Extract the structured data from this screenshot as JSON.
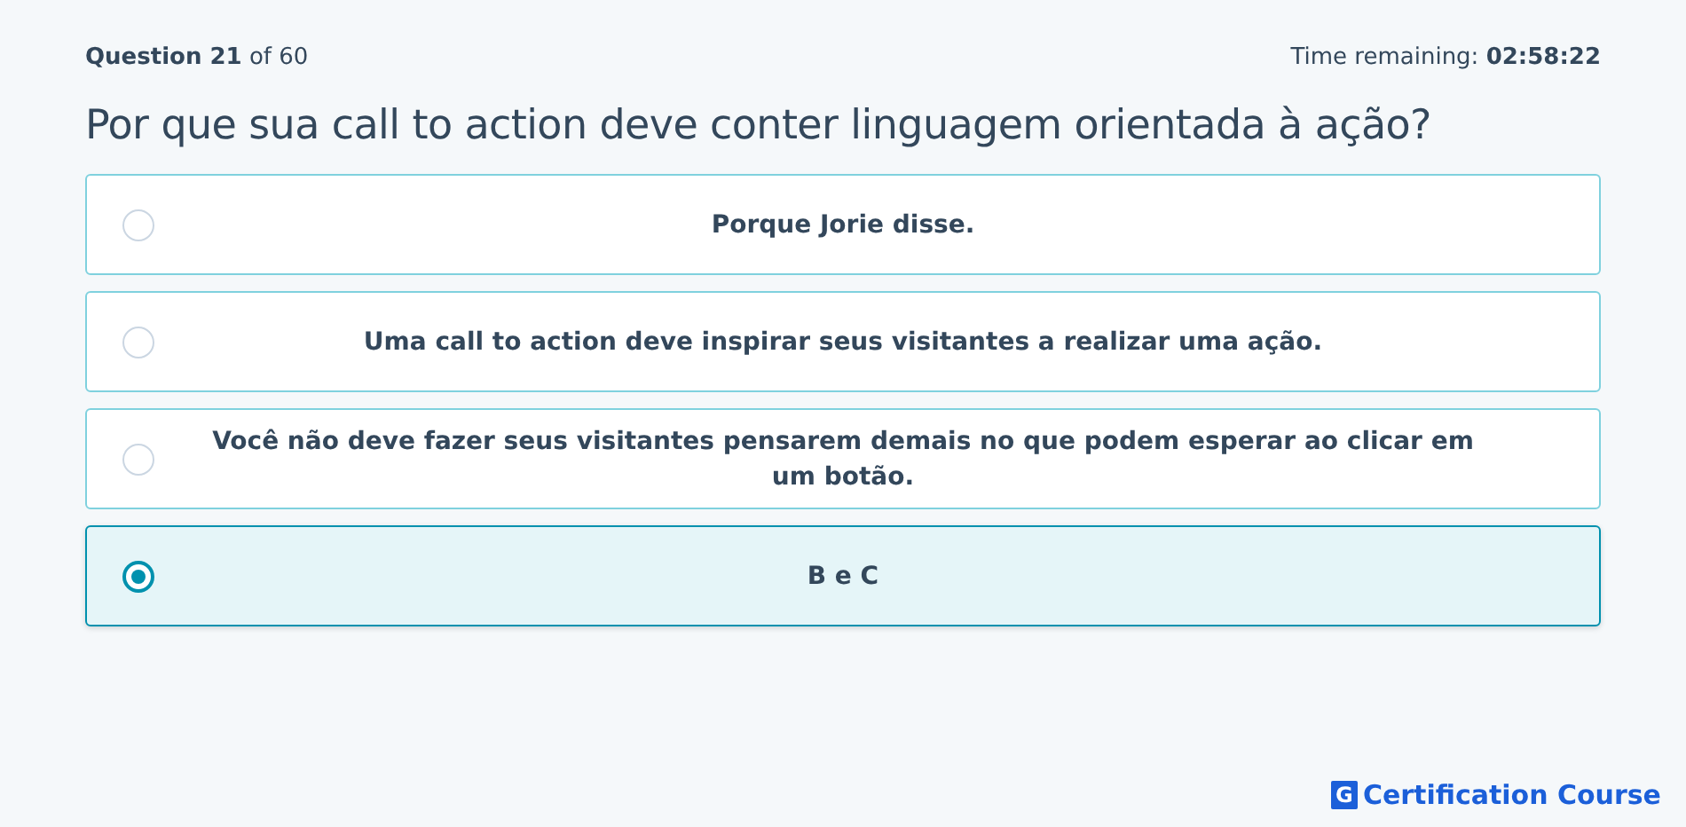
{
  "header": {
    "progress": "**Question 21** of 60",
    "timer": "Time remaining: **02:58:22**"
  },
  "question": "Por que sua call to action deve conter linguagem orientada à ação?",
  "options": [
    {
      "label": "Porque Jorie disse.",
      "selected": false
    },
    {
      "label": "Uma call to action deve inspirar seus visitantes a realizar uma ação.",
      "selected": false
    },
    {
      "label": "Você não deve fazer seus visitantes pensarem demais no que podem esperar ao clicar em um botão.",
      "selected": false
    },
    {
      "label": "B e C",
      "selected": true
    }
  ],
  "footer": {
    "logo_letter": "G",
    "brand": "Certification Course"
  }
}
